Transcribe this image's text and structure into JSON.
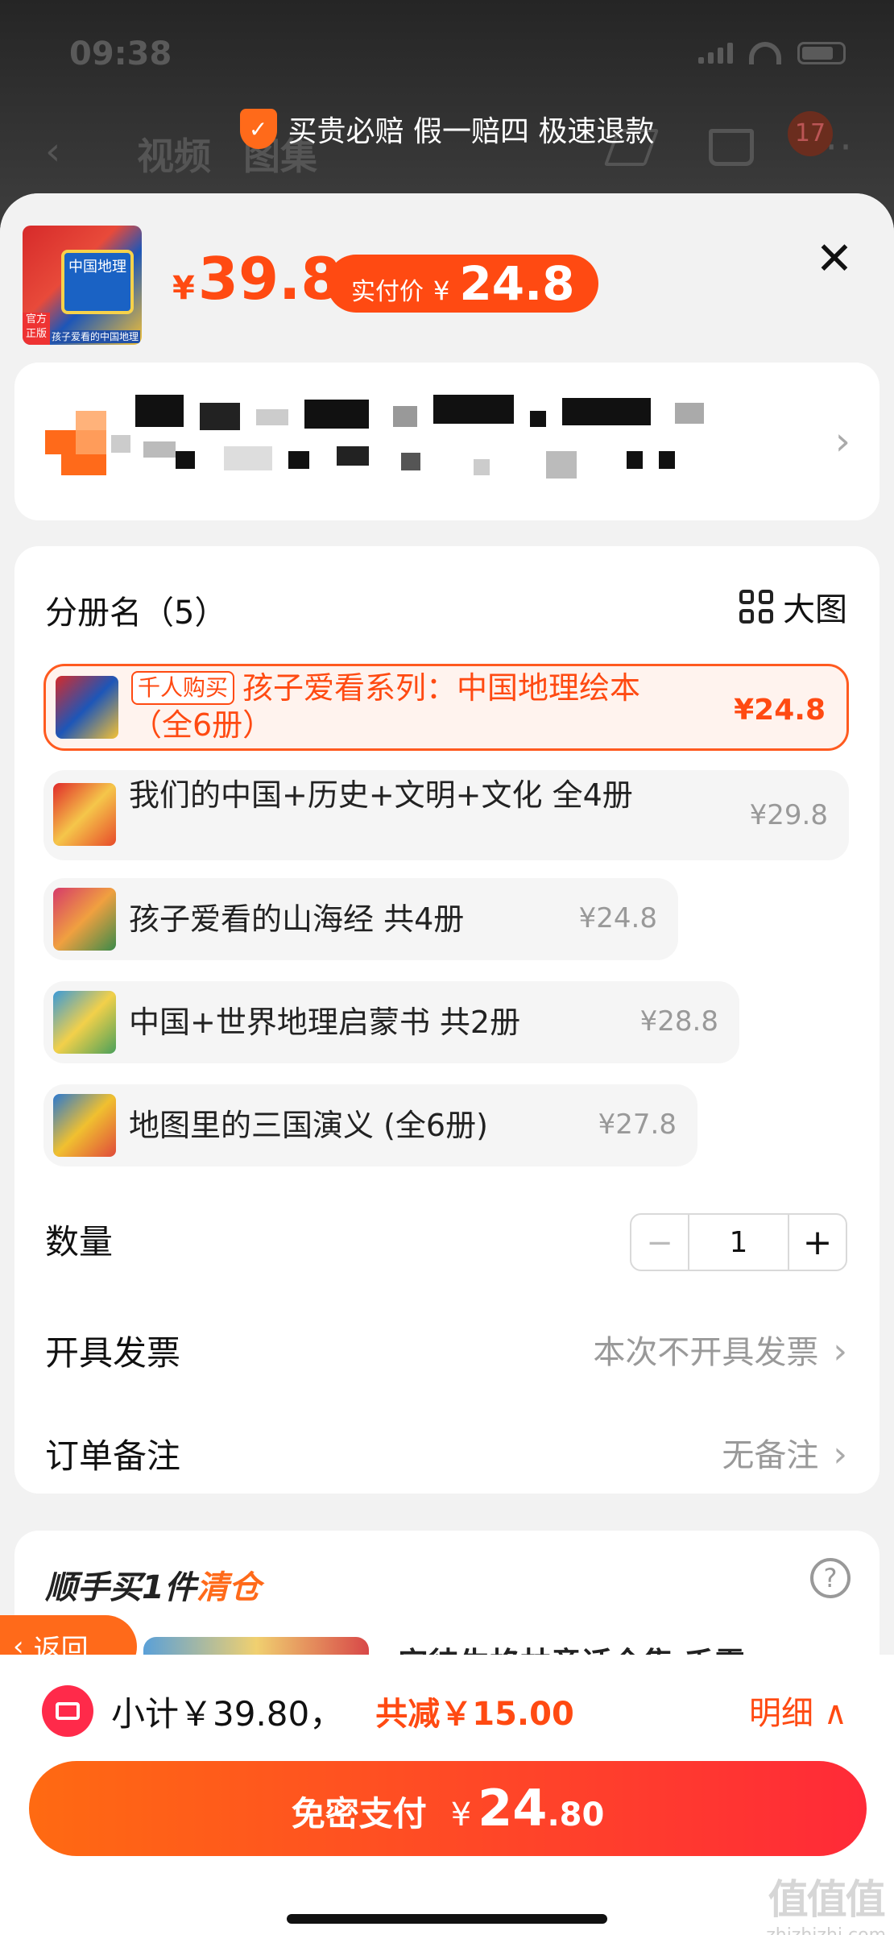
{
  "status_bar": {
    "time": "09:38"
  },
  "bg_nav": {
    "back": "‹",
    "tabs": [
      "视频",
      "图集"
    ],
    "cart_badge": "17",
    "more": "···"
  },
  "guarantee": {
    "icon": "shield-check-icon",
    "text": "买贵必赔 假一赔四 极速退款"
  },
  "product": {
    "thumb_tag": "官方正版",
    "thumb_title": "中国地理",
    "thumb_caption": "孩子爱看的中国地理",
    "currency": "¥",
    "price": "39.8",
    "pay_label": "实付价",
    "pay_currency": "¥",
    "pay_price": "24.8"
  },
  "address": {
    "arrow": "›"
  },
  "variants": {
    "title": "分册名（5）",
    "big_view": "大图",
    "items": [
      {
        "badge": "千人购买",
        "name": "孩子爱看系列：中国地理绘本（全6册）",
        "price": "¥24.8"
      },
      {
        "name": "我们的中国+历史+文明+文化 全4册",
        "price": "¥29.8"
      },
      {
        "name": "孩子爱看的山海经 共4册",
        "price": "¥24.8"
      },
      {
        "name": "中国+世界地理启蒙书 共2册",
        "price": "¥28.8"
      },
      {
        "name": "地图里的三国演义 (全6册)",
        "price": "¥27.8"
      }
    ]
  },
  "quantity": {
    "label": "数量",
    "minus": "−",
    "value": "1",
    "plus": "+"
  },
  "invoice": {
    "label": "开具发票",
    "value": "本次不开具发票",
    "arrow": "›"
  },
  "note": {
    "label": "订单备注",
    "value": "无备注",
    "arrow": "›"
  },
  "addon": {
    "title_prefix": "顺手买1件",
    "title_accent": "清仓",
    "help": "?",
    "item_text": "安徒生格林童话全集 千零"
  },
  "back_button": {
    "arrow": "‹",
    "label": "返回"
  },
  "footer": {
    "subtotal": "小计￥39.80，",
    "discount": "共减￥15.00",
    "detail": "明细 ∧",
    "pay_label": "免密支付",
    "pay_currency": "¥",
    "pay_amount": "24",
    "pay_decimal": ".80"
  },
  "watermark": {
    "logo": "值值值",
    "site": "zhizhizhi.com"
  },
  "colors": {
    "accent": "#ff4a12",
    "brand_orange": "#ff6a1a",
    "sheet_bg": "#f2f2f2"
  }
}
